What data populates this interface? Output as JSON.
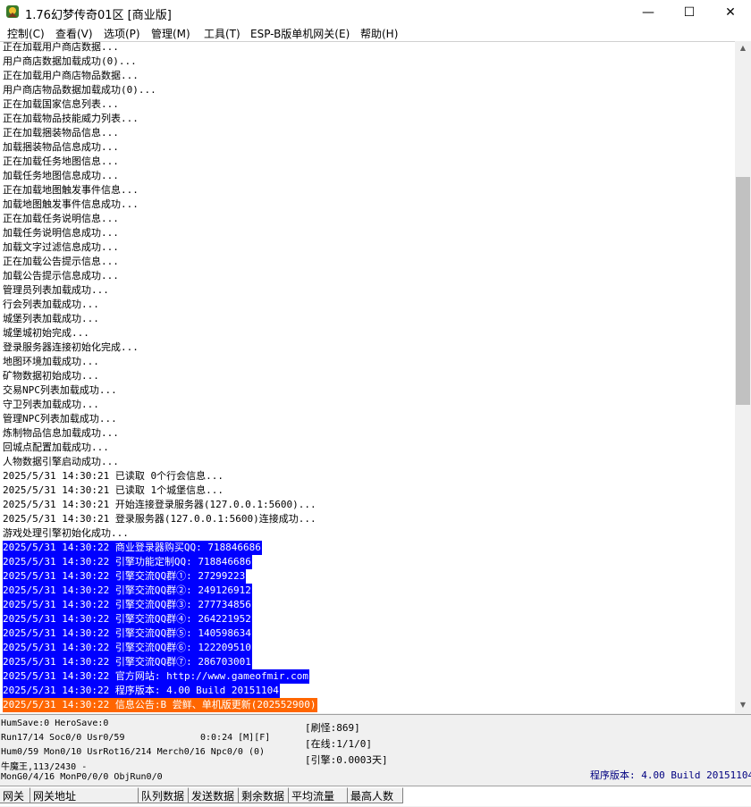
{
  "window": {
    "title": "1.76幻梦传奇01区 [商业版]",
    "minimize": "—",
    "maximize": "☐",
    "close": "✕"
  },
  "menu": [
    "控制(C)",
    "查看(V)",
    "选项(P)",
    "管理(M)",
    "工具(T)",
    "ESP-B版单机网关(E)",
    "帮助(H)"
  ],
  "log": [
    {
      "text": "正在加载用户商店数据...",
      "style": "normal"
    },
    {
      "text": "用户商店数据加载成功(0)...",
      "style": "normal"
    },
    {
      "text": "正在加载用户商店物品数据...",
      "style": "normal"
    },
    {
      "text": "用户商店物品数据加载成功(0)...",
      "style": "normal"
    },
    {
      "text": "正在加载国家信息列表...",
      "style": "normal"
    },
    {
      "text": "正在加载物品技能威力列表...",
      "style": "normal"
    },
    {
      "text": "正在加载捆装物品信息...",
      "style": "normal"
    },
    {
      "text": "加载捆装物品信息成功...",
      "style": "normal"
    },
    {
      "text": "正在加载任务地图信息...",
      "style": "normal"
    },
    {
      "text": "加载任务地图信息成功...",
      "style": "normal"
    },
    {
      "text": "正在加载地图触发事件信息...",
      "style": "normal"
    },
    {
      "text": "加载地图触发事件信息成功...",
      "style": "normal"
    },
    {
      "text": "正在加载任务说明信息...",
      "style": "normal"
    },
    {
      "text": "加载任务说明信息成功...",
      "style": "normal"
    },
    {
      "text": "加载文字过滤信息成功...",
      "style": "normal"
    },
    {
      "text": "正在加载公告提示信息...",
      "style": "normal"
    },
    {
      "text": "加载公告提示信息成功...",
      "style": "normal"
    },
    {
      "text": "管理员列表加载成功...",
      "style": "normal"
    },
    {
      "text": "行会列表加载成功...",
      "style": "normal"
    },
    {
      "text": "城堡列表加载成功...",
      "style": "normal"
    },
    {
      "text": "城堡城初始完成...",
      "style": "normal"
    },
    {
      "text": "登录服务器连接初始化完成...",
      "style": "normal"
    },
    {
      "text": "地图环境加载成功...",
      "style": "normal"
    },
    {
      "text": "矿物数据初始成功...",
      "style": "normal"
    },
    {
      "text": "交易NPC列表加载成功...",
      "style": "normal"
    },
    {
      "text": "守卫列表加载成功...",
      "style": "normal"
    },
    {
      "text": "管理NPC列表加载成功...",
      "style": "normal"
    },
    {
      "text": "炼制物品信息加载成功...",
      "style": "normal"
    },
    {
      "text": "回城点配置加载成功...",
      "style": "normal"
    },
    {
      "text": "人物数据引擎启动成功...",
      "style": "normal"
    },
    {
      "text": "2025/5/31 14:30:21 已读取 0个行会信息...",
      "style": "normal"
    },
    {
      "text": "2025/5/31 14:30:21 已读取 1个城堡信息...",
      "style": "normal"
    },
    {
      "text": "2025/5/31 14:30:21 开始连接登录服务器(127.0.0.1:5600)...",
      "style": "normal"
    },
    {
      "text": "2025/5/31 14:30:21 登录服务器(127.0.0.1:5600)连接成功...",
      "style": "normal"
    },
    {
      "text": "游戏处理引擎初始化成功...",
      "style": "normal"
    },
    {
      "text": "2025/5/31 14:30:22 商业登录器购买QQ: 718846686",
      "style": "blue"
    },
    {
      "text": "2025/5/31 14:30:22 引擎功能定制QQ: 718846686",
      "style": "blue"
    },
    {
      "text": "2025/5/31 14:30:22 引擎交流QQ群①: 27299223",
      "style": "blue"
    },
    {
      "text": "2025/5/31 14:30:22 引擎交流QQ群②: 249126912",
      "style": "blue"
    },
    {
      "text": "2025/5/31 14:30:22 引擎交流QQ群③: 277734856",
      "style": "blue"
    },
    {
      "text": "2025/5/31 14:30:22 引擎交流QQ群④: 264221952",
      "style": "blue"
    },
    {
      "text": "2025/5/31 14:30:22 引擎交流QQ群⑤: 140598634",
      "style": "blue"
    },
    {
      "text": "2025/5/31 14:30:22 引擎交流QQ群⑥: 122209510",
      "style": "blue"
    },
    {
      "text": "2025/5/31 14:30:22 引擎交流QQ群⑦: 286703001",
      "style": "blue"
    },
    {
      "text": "2025/5/31 14:30:22 官方网站: http://www.gameofmir.com",
      "style": "blue"
    },
    {
      "text": "2025/5/31 14:30:22 程序版本: 4.00 Build 20151104",
      "style": "blue"
    },
    {
      "text": "2025/5/31 14:30:22 信息公告:B 尝鲜、单机版更新(202552900)",
      "style": "orange"
    }
  ],
  "status": {
    "save": "HumSave:0 HeroSave:0",
    "run": "Run17/14 Soc0/0 Usr0/59",
    "timer": "0:0:24 [M][F]",
    "hum": "Hum0/59 Mon0/10 UsrRot16/214 Merch0/16 Npc0/0 (0)",
    "player": "牛魔王,113/2430 -",
    "mon": "MonG0/4/16 MonP0/0/0 ObjRun0/0",
    "refresh": "[刷怪:869]",
    "online": "[在线:1/1/0]",
    "engine": "[引擎:0.0003天]",
    "version": "程序版本: 4.00 Build 20151104"
  },
  "columns": [
    "网关",
    "网关地址",
    "队列数据",
    "发送数据",
    "剩余数据",
    "平均流量",
    "最高人数"
  ]
}
